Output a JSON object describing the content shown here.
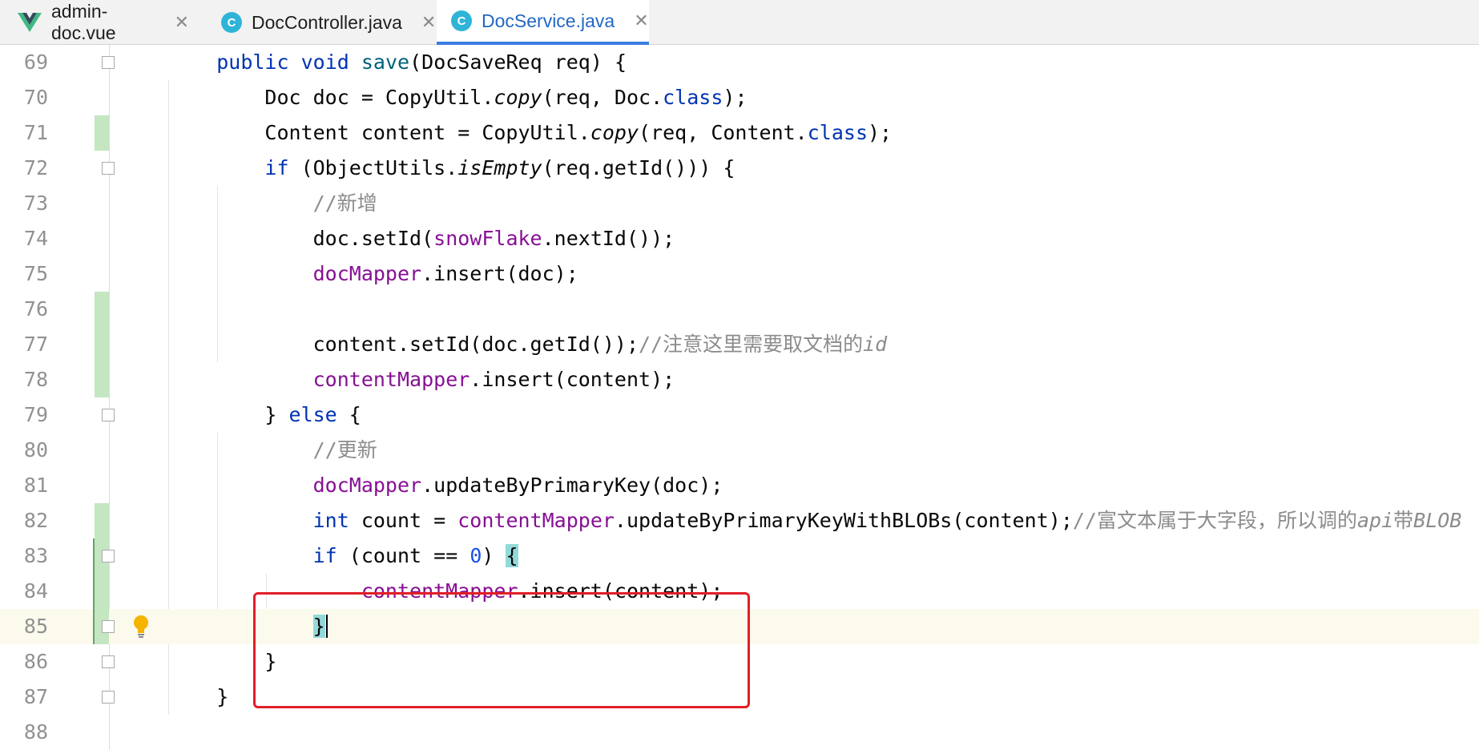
{
  "tabs": [
    {
      "label": "admin-doc.vue",
      "icon": "vue-icon",
      "active": false
    },
    {
      "label": "DocController.java",
      "icon": "java-class-icon",
      "active": false
    },
    {
      "label": "DocService.java",
      "icon": "java-class-icon",
      "active": true
    }
  ],
  "close_glyph": "✕",
  "lines": [
    {
      "n": "69",
      "tokens": [
        [
          "",
          "    "
        ],
        [
          "kw",
          "public"
        ],
        [
          "",
          " "
        ],
        [
          "kw",
          "void"
        ],
        [
          "",
          " "
        ],
        [
          "fn",
          "save"
        ],
        [
          "",
          "(DocSaveReq req) {"
        ]
      ]
    },
    {
      "n": "70",
      "tokens": [
        [
          "",
          "        Doc doc = CopyUtil."
        ],
        [
          "it",
          "copy"
        ],
        [
          "",
          "(req, Doc."
        ],
        [
          "kw",
          "class"
        ],
        [
          "",
          ");"
        ]
      ]
    },
    {
      "n": "71",
      "tokens": [
        [
          "",
          "        Content content = CopyUtil."
        ],
        [
          "it",
          "copy"
        ],
        [
          "",
          "(req, Content."
        ],
        [
          "kw",
          "class"
        ],
        [
          "",
          ");"
        ]
      ]
    },
    {
      "n": "72",
      "tokens": [
        [
          "",
          "        "
        ],
        [
          "kw",
          "if"
        ],
        [
          "",
          " (ObjectUtils."
        ],
        [
          "it",
          "isEmpty"
        ],
        [
          "",
          "(req.getId())) {"
        ]
      ]
    },
    {
      "n": "73",
      "tokens": [
        [
          "",
          "            "
        ],
        [
          "cm",
          "//新增"
        ]
      ]
    },
    {
      "n": "74",
      "tokens": [
        [
          "",
          "            doc.setId("
        ],
        [
          "field",
          "snowFlake"
        ],
        [
          "",
          ".nextId());"
        ]
      ]
    },
    {
      "n": "75",
      "tokens": [
        [
          "",
          "            "
        ],
        [
          "field",
          "docMapper"
        ],
        [
          "",
          ".insert(doc);"
        ]
      ]
    },
    {
      "n": "76",
      "tokens": []
    },
    {
      "n": "77",
      "tokens": [
        [
          "",
          "            content.setId(doc.getId());"
        ],
        [
          "cm",
          "//注意这里需要取文档的"
        ],
        [
          "cmi",
          "id"
        ]
      ]
    },
    {
      "n": "78",
      "tokens": [
        [
          "",
          "            "
        ],
        [
          "field",
          "contentMapper"
        ],
        [
          "",
          ".insert(content);"
        ]
      ]
    },
    {
      "n": "79",
      "tokens": [
        [
          "",
          "        } "
        ],
        [
          "kw",
          "else"
        ],
        [
          "",
          " {"
        ]
      ]
    },
    {
      "n": "80",
      "tokens": [
        [
          "",
          "            "
        ],
        [
          "cm",
          "//更新"
        ]
      ]
    },
    {
      "n": "81",
      "tokens": [
        [
          "",
          "            "
        ],
        [
          "field",
          "docMapper"
        ],
        [
          "",
          ".updateByPrimaryKey(doc);"
        ]
      ]
    },
    {
      "n": "82",
      "tokens": [
        [
          "",
          "            "
        ],
        [
          "kw",
          "int"
        ],
        [
          "",
          " count = "
        ],
        [
          "field",
          "contentMapper"
        ],
        [
          "",
          ".updateByPrimaryKeyWithBLOBs(content);"
        ],
        [
          "cm",
          "//富文本属于大字段，所以调的"
        ],
        [
          "cmi",
          "api"
        ],
        [
          "cm",
          "带"
        ],
        [
          "cmi",
          "BLOB"
        ]
      ]
    },
    {
      "n": "83",
      "tokens": [
        [
          "",
          "            "
        ],
        [
          "kw",
          "if"
        ],
        [
          "",
          " (count == "
        ],
        [
          "num",
          "0"
        ],
        [
          "",
          ") "
        ],
        [
          "brace-match",
          "{"
        ]
      ]
    },
    {
      "n": "84",
      "tokens": [
        [
          "",
          "                "
        ],
        [
          "field",
          "contentMapper"
        ],
        [
          "",
          ".insert(content);"
        ]
      ]
    },
    {
      "n": "85",
      "tokens": [
        [
          "",
          "            "
        ],
        [
          "brace-match",
          "}"
        ],
        [
          "caret",
          ""
        ]
      ]
    },
    {
      "n": "86",
      "tokens": [
        [
          "",
          "        }"
        ]
      ]
    },
    {
      "n": "87",
      "tokens": [
        [
          "",
          "    }"
        ]
      ]
    },
    {
      "n": "88",
      "tokens": []
    }
  ],
  "current_line": "85",
  "fold_markers": [
    "69",
    "72",
    "79",
    "83",
    "85",
    "86",
    "87"
  ],
  "vcs_changed_lines": [
    "71",
    "76",
    "77",
    "78",
    "82",
    "83",
    "84",
    "85"
  ],
  "intention_bulb_line": "85",
  "colors": {
    "keyword": "#0033b3",
    "method": "#00627a",
    "field": "#871094",
    "comment": "#8c8c8c",
    "number": "#1750eb",
    "highlight_box": "#e21e26",
    "active_tab": "#2368c4"
  }
}
